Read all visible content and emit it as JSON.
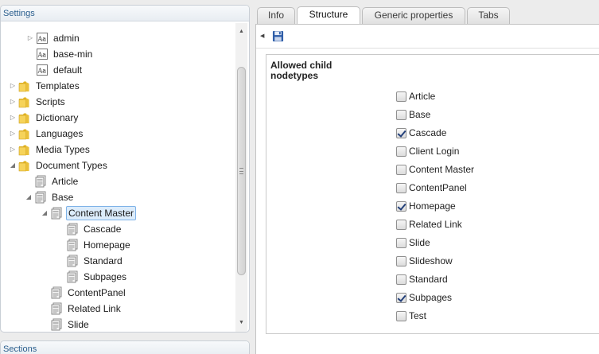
{
  "settings": {
    "header": "Settings",
    "tree": [
      {
        "label": "admin",
        "icon": "stylesheet-icon",
        "arrow": "right"
      },
      {
        "label": "base-min",
        "icon": "stylesheet-icon",
        "arrow": ""
      },
      {
        "label": "default",
        "icon": "stylesheet-icon",
        "arrow": ""
      },
      {
        "label": "Templates",
        "icon": "folder-icon",
        "arrow": "right"
      },
      {
        "label": "Scripts",
        "icon": "folder-icon",
        "arrow": "right"
      },
      {
        "label": "Dictionary",
        "icon": "folder-icon",
        "arrow": "right"
      },
      {
        "label": "Languages",
        "icon": "folder-icon",
        "arrow": "right"
      },
      {
        "label": "Media Types",
        "icon": "folder-icon",
        "arrow": "right"
      },
      {
        "label": "Document Types",
        "icon": "folder-icon",
        "arrow": "down"
      },
      {
        "label": "Article",
        "icon": "doctype-icon",
        "arrow": ""
      },
      {
        "label": "Base",
        "icon": "doctype-icon",
        "arrow": "down"
      },
      {
        "label": "Content Master",
        "icon": "doctype-icon",
        "arrow": "down",
        "selected": true
      },
      {
        "label": "Cascade",
        "icon": "doctype-icon",
        "arrow": ""
      },
      {
        "label": "Homepage",
        "icon": "doctype-icon",
        "arrow": ""
      },
      {
        "label": "Standard",
        "icon": "doctype-icon",
        "arrow": ""
      },
      {
        "label": "Subpages",
        "icon": "doctype-icon",
        "arrow": ""
      },
      {
        "label": "ContentPanel",
        "icon": "doctype-icon",
        "arrow": ""
      },
      {
        "label": "Related Link",
        "icon": "doctype-icon",
        "arrow": ""
      },
      {
        "label": "Slide",
        "icon": "doctype-icon",
        "arrow": ""
      }
    ]
  },
  "sections": {
    "header": "Sections"
  },
  "tabs": [
    {
      "label": "Info",
      "active": false
    },
    {
      "label": "Structure",
      "active": true
    },
    {
      "label": "Generic properties",
      "active": false
    },
    {
      "label": "Tabs",
      "active": false
    }
  ],
  "toolbar": {
    "save_icon": "save-icon"
  },
  "structure": {
    "label": "Allowed child nodetypes",
    "options": [
      {
        "label": "Article",
        "checked": false
      },
      {
        "label": "Base",
        "checked": false
      },
      {
        "label": "Cascade",
        "checked": true
      },
      {
        "label": "Client Login",
        "checked": false
      },
      {
        "label": "Content Master",
        "checked": false
      },
      {
        "label": "ContentPanel",
        "checked": false
      },
      {
        "label": "Homepage",
        "checked": true
      },
      {
        "label": "Related Link",
        "checked": false
      },
      {
        "label": "Slide",
        "checked": false
      },
      {
        "label": "Slideshow",
        "checked": false
      },
      {
        "label": "Standard",
        "checked": false
      },
      {
        "label": "Subpages",
        "checked": true
      },
      {
        "label": "Test",
        "checked": false
      }
    ]
  },
  "colors": {
    "header_text": "#2b5f8e",
    "selection_bg": "#dcecfb",
    "checkmark": "#23407a"
  }
}
